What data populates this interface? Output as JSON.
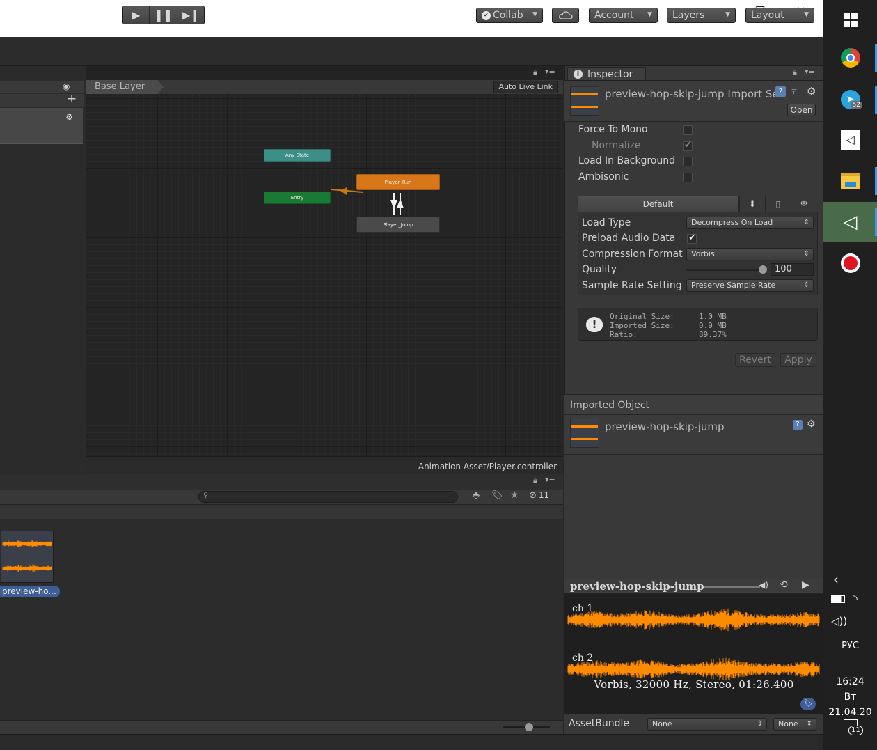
{
  "window": {
    "minimize_glyph": "—",
    "maximize_glyph": "❐",
    "close_glyph": "✕"
  },
  "toolbar": {
    "collab_label": "Collab",
    "account_label": "Account",
    "layers_label": "Layers",
    "layout_label": "Layout"
  },
  "animator": {
    "breadcrumb": "Base Layer",
    "auto_live_link": "Auto Live Link",
    "nodes": {
      "any_state": "Any State",
      "entry": "Entry",
      "player_run": "Player_Run",
      "player_jump": "Player_Jump"
    },
    "footer": "Animation Asset/Player.controller"
  },
  "project": {
    "hidden_count": "11",
    "asset_label": "preview-ho..."
  },
  "inspector": {
    "tab_label": "Inspector",
    "title": "preview-hop-skip-jump Import Settings",
    "open_button": "Open",
    "options": {
      "force_to_mono": "Force To Mono",
      "normalize": "Normalize",
      "load_in_background": "Load In Background",
      "ambisonic": "Ambisonic"
    },
    "platform": {
      "default_tab": "Default",
      "load_type_label": "Load Type",
      "load_type_value": "Decompress On Load",
      "preload_label": "Preload Audio Data",
      "compression_label": "Compression Format",
      "compression_value": "Vorbis",
      "quality_label": "Quality",
      "quality_value": "100",
      "quality_fraction": 1.0,
      "sample_rate_label": "Sample Rate Setting",
      "sample_rate_value": "Preserve Sample Rate"
    },
    "info": {
      "original_label": "Original Size:",
      "imported_label": "Imported Size:",
      "ratio_label": "Ratio:",
      "original_value": "1.0 MB",
      "imported_value": "0.9 MB",
      "ratio_value": "89.37%"
    },
    "revert_button": "Revert",
    "apply_button": "Apply",
    "imported_object_header": "Imported Object",
    "imported_object_name": "preview-hop-skip-jump"
  },
  "preview": {
    "title": "preview-hop-skip-jump",
    "channel1": "ch 1",
    "channel2": "ch 2",
    "info": "Vorbis, 32000 Hz, Stereo, 01:26.400",
    "assetbundle_label": "AssetBundle",
    "assetbundle_value": "None",
    "variant_value": "None"
  },
  "taskbar": {
    "telegram_badge": "52",
    "language": "РУС",
    "time": "16:24",
    "date": "Вт 21.04.20",
    "notifications": "11"
  },
  "colors": {
    "waveform": "#ff8c00",
    "node_orange": "#d8771a",
    "node_green": "#1a7a33",
    "node_teal": "#3b8f86",
    "selection_blue": "#3e5f96"
  }
}
